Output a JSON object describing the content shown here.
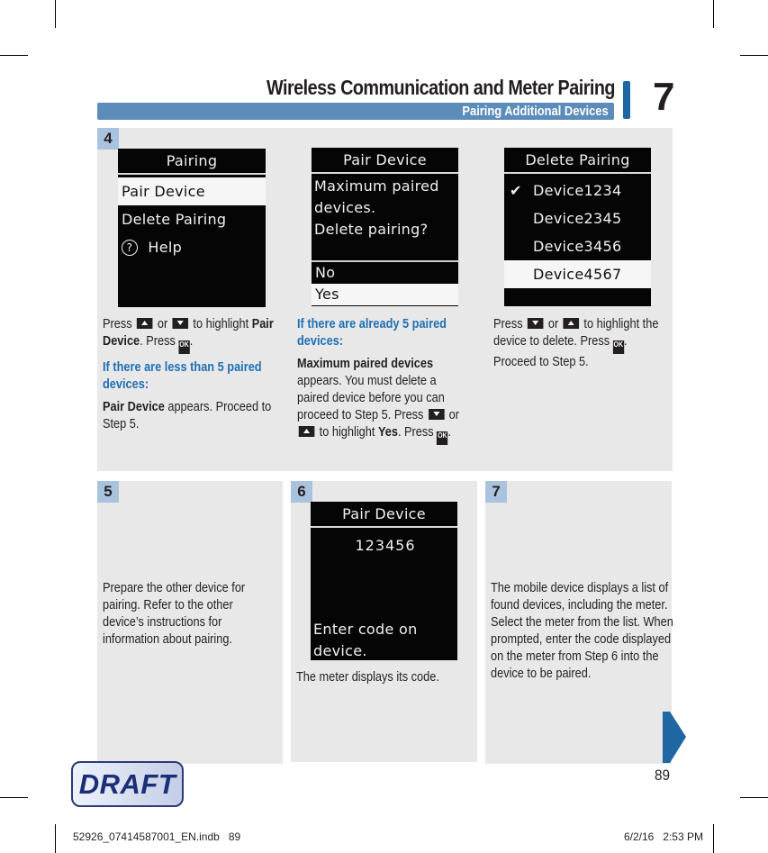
{
  "header": {
    "title": "Wireless Communication and Meter Pairing",
    "subtitle": "Pairing Additional Devices",
    "chapter": "7"
  },
  "step4": {
    "number": "4",
    "screen_a": {
      "title": "Pairing",
      "items": [
        "Pair Device",
        "Delete Pairing",
        "Help"
      ],
      "selected": "Pair Device"
    },
    "screen_b": {
      "title": "Pair Device",
      "message": [
        "Maximum paired",
        "devices.",
        "Delete pairing?"
      ],
      "options": [
        "No",
        "Yes"
      ],
      "selected": "Yes"
    },
    "screen_c": {
      "title": "Delete Pairing",
      "items": [
        "Device1234",
        "Device2345",
        "Device3456",
        "Device4567"
      ],
      "checked": "Device1234",
      "selected": "Device4567"
    },
    "col1": {
      "press": "Press",
      "or": "or",
      "to_highlight": "to highlight",
      "pair": "Pair",
      "device_bold": "Device",
      "press2": ". Press",
      "heading": "If there are less than 5 paired devices:",
      "result_bold": "Pair Device",
      "result_rest": "appears. Proceed to Step 5."
    },
    "col2": {
      "heading": "If there are already 5 paired devices:",
      "msg_bold": "Maximum paired devices",
      "body": "appears. You must delete a paired device before you can proceed to Step 5. Press",
      "or": "or",
      "to_highlight": "to highlight",
      "yes": "Yes",
      "press": ". Press"
    },
    "col3": {
      "press": "Press",
      "or": "or",
      "rest": "to highlight the device to delete. Press",
      "proceed": "Proceed to Step 5."
    }
  },
  "step5": {
    "number": "5",
    "text": "Prepare the other device for pairing. Refer to the other device’s instructions for information about pairing."
  },
  "step6": {
    "number": "6",
    "screen": {
      "title": "Pair Device",
      "code": "123456",
      "message": [
        "Enter code on",
        "device."
      ]
    },
    "text": "The meter displays its code."
  },
  "step7": {
    "number": "7",
    "text": "The mobile device displays a list of found devices, including the meter. Select the meter from the list. When prompted, enter the code displayed on the meter from Step 6 into the device to be paired."
  },
  "icons": {
    "up": "up-button-icon",
    "down": "down-button-icon",
    "ok": "OK"
  },
  "page_number": "89",
  "watermark": "DRAFT",
  "footer": {
    "file": "52926_07414587001_EN.indb   89",
    "timestamp": "6/2/16   2:53 PM"
  },
  "colors": {
    "accent_blue": "#1f6fb3",
    "bar_blue": "#5b8cba",
    "panel_gray": "#e8e8e8",
    "badge_blue": "#a9c3de"
  }
}
